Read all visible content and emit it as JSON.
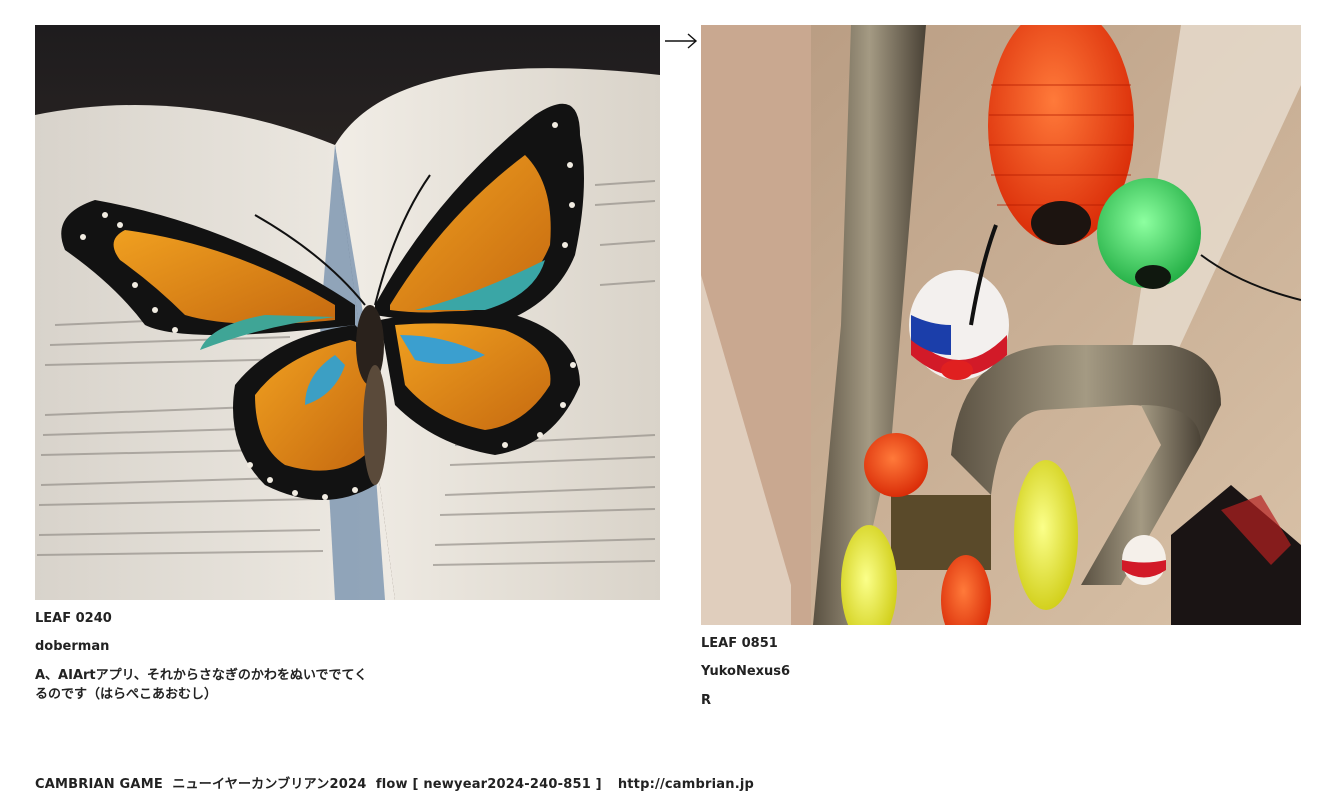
{
  "leaves": [
    {
      "id": "LEAF 0240",
      "author": "doberman",
      "comment": "A、AIArtアプリ、それからさなぎのかわをぬいででてくるのです（はらぺこあおむし）",
      "image_subject": "butterfly-on-book"
    },
    {
      "id": "LEAF 0851",
      "author": "YukoNexus6",
      "comment": "R",
      "image_subject": "paper-lanterns-ceiling"
    }
  ],
  "arrow_icon": "right-arrow-icon",
  "footer": {
    "title": "CAMBRIAN GAME  ニューイヤーカンブリアン2024  flow [ newyear2024-240-851 ]",
    "url": "http://cambrian.jp"
  }
}
